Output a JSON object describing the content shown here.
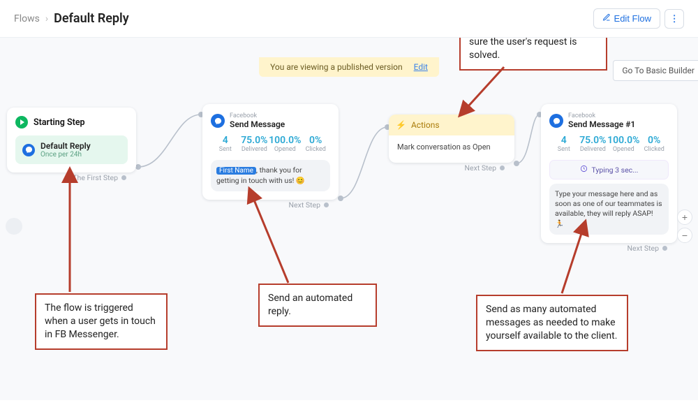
{
  "breadcrumb": {
    "parent": "Flows",
    "current": "Default Reply"
  },
  "header": {
    "edit_flow": "Edit Flow",
    "basic_builder": "Go To Basic Builder"
  },
  "banner": {
    "text": "You are viewing a published version",
    "edit": "Edit"
  },
  "start_node": {
    "title": "Starting Step",
    "chip_title": "Default Reply",
    "chip_sub": "Once per 24h",
    "port": "The First Step"
  },
  "msg_node": {
    "fb": "Facebook",
    "name": "Send Message",
    "stats": [
      {
        "val": "4",
        "lbl": "Sent"
      },
      {
        "val": "75.0%",
        "lbl": "Delivered"
      },
      {
        "val": "100.0%",
        "lbl": "Opened"
      },
      {
        "val": "0%",
        "lbl": "Clicked"
      }
    ],
    "fn": "First Name",
    "bubble_rest": ", thank you for getting in touch with us! 😊",
    "port": "Next Step"
  },
  "actions_node": {
    "title": "Actions",
    "body": "Mark conversation as Open",
    "port": "Next Step"
  },
  "msg2_node": {
    "fb": "Facebook",
    "name": "Send Message #1",
    "stats": [
      {
        "val": "4",
        "lbl": "Sent"
      },
      {
        "val": "75.0%",
        "lbl": "Delivered"
      },
      {
        "val": "100.0%",
        "lbl": "Opened"
      },
      {
        "val": "0%",
        "lbl": "Clicked"
      }
    ],
    "typing": "Typing 3 sec...",
    "bubble": "Type your message here and as soon as one of our teammates is available, they will reply ASAP! 🏃",
    "port": "Next Step"
  },
  "annotations": {
    "a1": "The flow is triggered when a user gets in touch in FB Messenger.",
    "a2": "Send an automated reply.",
    "a3": "The conversation remains open in your system to make sure the user's request is solved.",
    "a4": "Send as many automated messages as needed to make yourself available to the client."
  },
  "zoom": {
    "in": "+",
    "out": "−"
  }
}
